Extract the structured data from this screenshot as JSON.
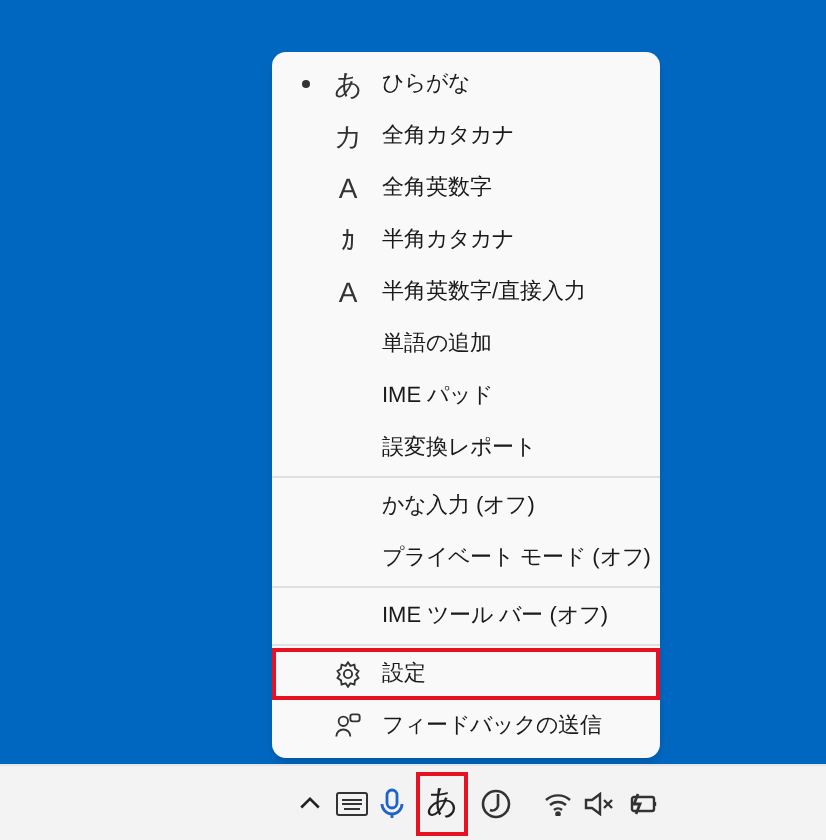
{
  "menu": {
    "groups": [
      {
        "items": [
          {
            "kind": "mode",
            "glyph": "あ",
            "label": "ひらがな",
            "selected": true
          },
          {
            "kind": "mode",
            "glyph": "カ",
            "label": "全角カタカナ",
            "selected": false
          },
          {
            "kind": "mode",
            "glyph": "A",
            "label": "全角英数字",
            "selected": false
          },
          {
            "kind": "mode",
            "glyph": "ｶ",
            "label": "半角カタカナ",
            "selected": false
          },
          {
            "kind": "mode",
            "glyph": "A",
            "label": "半角英数字/直接入力",
            "selected": false
          },
          {
            "kind": "command",
            "label": "単語の追加",
            "highlighted": false
          },
          {
            "kind": "command",
            "label": "IME パッド",
            "highlighted": false
          },
          {
            "kind": "command",
            "label": "誤変換レポート",
            "highlighted": false
          }
        ]
      },
      {
        "items": [
          {
            "kind": "command",
            "label": "かな入力 (オフ)",
            "highlighted": false
          },
          {
            "kind": "command",
            "label": "プライベート モード (オフ)",
            "highlighted": false
          }
        ]
      },
      {
        "items": [
          {
            "kind": "command",
            "label": "IME ツール バー (オフ)",
            "highlighted": false
          }
        ]
      },
      {
        "items": [
          {
            "kind": "settings",
            "label": "設定",
            "highlighted": true
          },
          {
            "kind": "feedback",
            "label": "フィードバックの送信",
            "highlighted": false
          }
        ]
      }
    ]
  },
  "taskbar": {
    "ime_indicator": {
      "label": "あ",
      "highlighted": true
    }
  }
}
